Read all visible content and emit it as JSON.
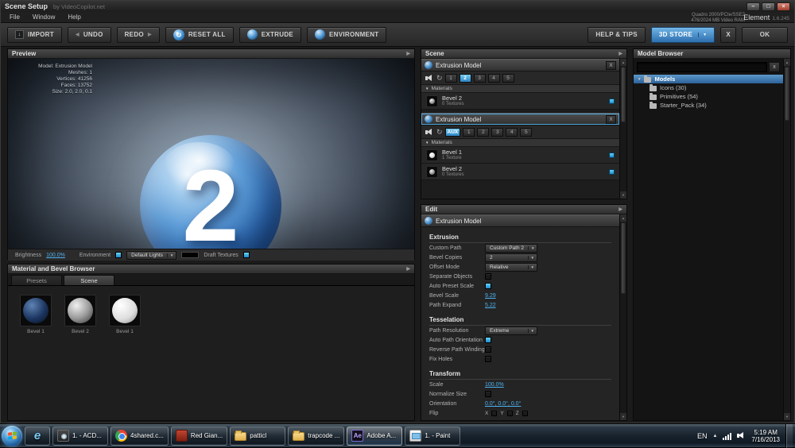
{
  "colors": {
    "accent_blue": "#3db3e8",
    "store_blue": "#3f8fd2",
    "selection_blue": "#4fa8e0",
    "value_link": "#4db1f0"
  },
  "window": {
    "title": "Scene Setup",
    "title_dim": "by VideoCopilot.net",
    "menu": [
      "File",
      "Window",
      "Help"
    ],
    "gpu_line1": "Quadro 2000/PCIe/SSE2",
    "gpu_line2": "476/2024 MB Video RAM",
    "brand": "Element",
    "version": "1.6.245",
    "min": "–",
    "max": "□",
    "close": "×"
  },
  "toolbar": {
    "import": "IMPORT",
    "undo": "UNDO",
    "redo": "REDO",
    "reset_all": "RESET ALL",
    "extrude": "EXTRUDE",
    "environment": "ENVIRONMENT",
    "help_tips": "HELP & TIPS",
    "store": "3D STORE",
    "close_x": "X",
    "ok": "OK"
  },
  "preview": {
    "header": "Preview",
    "info": [
      "Model: Extrusion Model",
      "Meshes: 1",
      "Vertices: 41256",
      "Faces: 13752",
      "Size: 2.0, 2.0, 0.1"
    ],
    "sphere_label": "2",
    "brightness_label": "Brightness",
    "brightness_value": "100.0%",
    "environment_label": "Environment",
    "lights_value": "Default Lights",
    "draft_label": "Draft Textures"
  },
  "material_browser": {
    "header": "Material and Bevel Browser",
    "tabs": [
      "Presets",
      "Scene"
    ],
    "materials": [
      {
        "name": "Bevel 1"
      },
      {
        "name": "Bevel 2"
      },
      {
        "name": "Bevel 1"
      }
    ]
  },
  "scene": {
    "header": "Scene",
    "materials_label": "Materials",
    "groups": [
      {
        "title": "Extrusion Model",
        "close": "X",
        "slots": [
          "1",
          "2",
          "3",
          "4",
          "5"
        ],
        "materials": [
          {
            "name": "Bevel 2",
            "textures": "0 Textures"
          }
        ]
      },
      {
        "title": "Extrusion Model",
        "close": "X",
        "aux": "AUX",
        "slots": [
          "1",
          "2",
          "3",
          "4",
          "5"
        ],
        "materials": [
          {
            "name": "Bevel 1",
            "textures": "1 Texture"
          },
          {
            "name": "Bevel 2",
            "textures": "0 Textures"
          }
        ]
      }
    ]
  },
  "edit": {
    "header": "Edit",
    "item": "Extrusion Model",
    "extrusion": {
      "title": "Extrusion",
      "custom_path": "Custom Path",
      "custom_path_value": "Custom Path 2",
      "bevel_copies": "Bevel Copies",
      "bevel_copies_value": "2",
      "offset_mode": "Offset Mode",
      "offset_mode_value": "Relative",
      "separate_objects": "Separate Objects",
      "auto_preset_scale": "Auto Preset Scale",
      "bevel_scale": "Bevel Scale",
      "bevel_scale_value": "9.29",
      "path_expand": "Path Expand",
      "path_expand_value": "5.22"
    },
    "tesselation": {
      "title": "Tesselation",
      "path_resolution": "Path Resolution",
      "path_resolution_value": "Extreme",
      "auto_path_orientation": "Auto Path Orientation",
      "reverse_path_winding": "Reverse Path Winding",
      "fix_holes": "Fix Holes"
    },
    "transform": {
      "title": "Transform",
      "scale": "Scale",
      "scale_value": "100.0%",
      "normalize_size": "Normalize Size",
      "orientation": "Orientation",
      "orientation_value": "0.0°, 0.0°, 0.0°",
      "flip": "Flip",
      "flip_axes": [
        "X",
        "Y",
        "Z"
      ]
    }
  },
  "model_browser": {
    "header": "Model Browser",
    "root": "Models",
    "items": [
      "Icons (30)",
      "Primitives (54)",
      "Starter_Pack (34)"
    ]
  },
  "taskbar": {
    "buttons": [
      {
        "label": "1. - ACD..."
      },
      {
        "label": "4shared.c..."
      },
      {
        "label": "Red Gian..."
      },
      {
        "label": "patticl"
      },
      {
        "label": "trapcode ..."
      },
      {
        "label": "Adobe A..."
      },
      {
        "label": "1. - Paint"
      }
    ],
    "lang": "EN",
    "time": "5:19 AM",
    "date": "7/16/2013"
  }
}
